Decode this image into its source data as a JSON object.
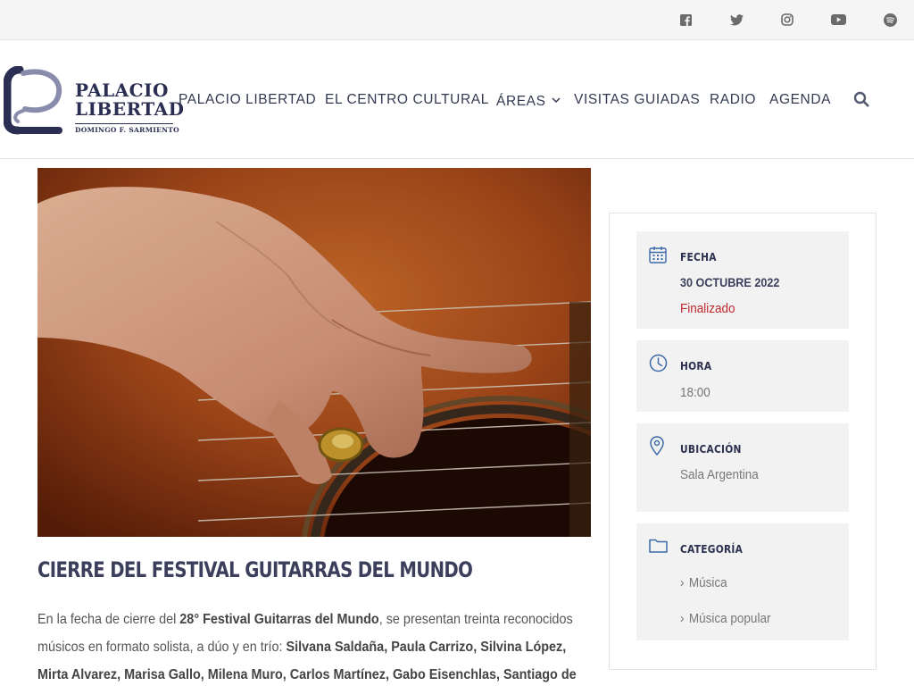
{
  "social": {
    "icons": [
      "facebook-icon",
      "twitter-icon",
      "instagram-icon",
      "youtube-icon",
      "spotify-icon"
    ]
  },
  "brand": {
    "line1": "PALACIO",
    "line2": "LIBERTAD",
    "line3": "DOMINGO F. SARMIENTO",
    "color": "#2a2e52",
    "accent": "#8a8cab"
  },
  "nav": {
    "items": [
      {
        "label": "PALACIO LIBERTAD"
      },
      {
        "label": "EL CENTRO CULTURAL"
      },
      {
        "label": "ÁREAS"
      },
      {
        "label": "VISITAS GUIADAS"
      },
      {
        "label": "RADIO"
      },
      {
        "label": "AGENDA"
      }
    ],
    "search_icon": "search-icon"
  },
  "article": {
    "title": "CIERRE DEL FESTIVAL GUITARRAS DEL MUNDO",
    "body": {
      "p1_a": "En la fecha de cierre del ",
      "p1_b": "28° Festival Guitarras del Mundo",
      "p1_c": ", se presentan treinta reconocidos músicos en formato solista, a dúo y en trío: ",
      "p1_d": "Silvana Saldaña, Paula Carrizo, Silvina López, Mirta Alvarez, Marisa Gallo, Milena Muro, Carlos Martínez, Gabo Eisenchlas, Santiago de"
    }
  },
  "event": {
    "fecha_label": "FECHA",
    "fecha_value": "30 OCTUBRE 2022",
    "status": "Finalizado",
    "hora_label": "HORA",
    "hora_value": "18:00",
    "ubicacion_label": "UBICACIÓN",
    "ubicacion_value": "Sala Argentina",
    "categoria_label": "CATEGORÍA",
    "categorias": [
      "Música",
      "Música popular"
    ],
    "status_color": "#c0262d"
  }
}
